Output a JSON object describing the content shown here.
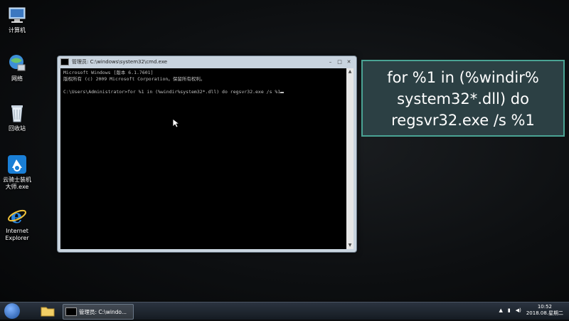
{
  "desktop": {
    "icons": [
      {
        "label": "计算机",
        "icon": "computer-icon"
      },
      {
        "label": "网络",
        "icon": "network-icon"
      },
      {
        "label": "回收站",
        "icon": "recycle-bin-icon"
      },
      {
        "label": "云骑士装机\n大师.exe",
        "icon": "installer-icon"
      },
      {
        "label": "Internet\nExplorer",
        "icon": "ie-icon"
      }
    ]
  },
  "cmd_window": {
    "title": "管理员: C:\\windows\\system32\\cmd.exe",
    "lines": [
      "Microsoft Windows [版本 6.1.7601]",
      "版权所有 (c) 2009 Microsoft Corporation。保留所有权利。",
      "",
      "C:\\Users\\Administrator>for %1 in (%windir%system32*.dll) do regsvr32.exe /s %1"
    ]
  },
  "callout": {
    "line1": "for %1 in (%windir%",
    "line2": "system32*.dll) do",
    "line3": "regsvr32.exe /s %1"
  },
  "taskbar": {
    "cmd_label": "管理员: C:\\windo...",
    "time": "10:52",
    "date": "2018.08.星期二"
  }
}
